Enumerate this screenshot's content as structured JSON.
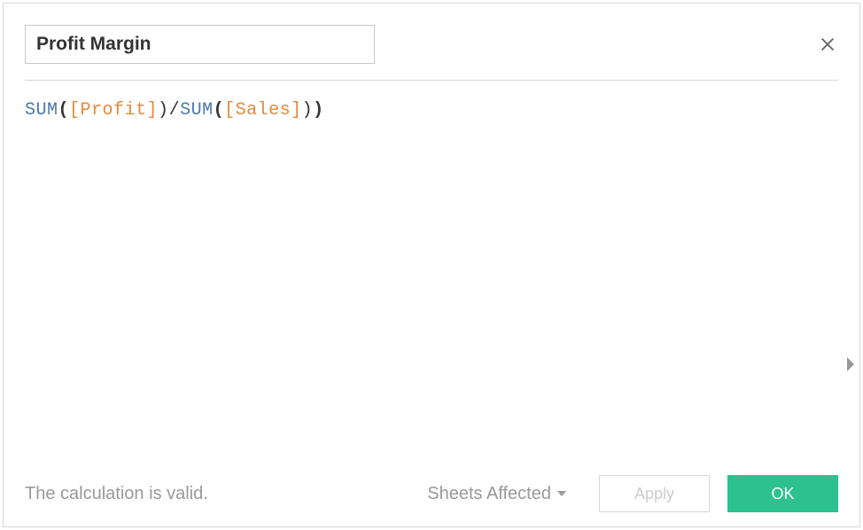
{
  "dialog": {
    "name_value": "Profit Margin",
    "formula_tokens": [
      {
        "type": "func",
        "text": "SUM"
      },
      {
        "type": "paren",
        "text": "(",
        "bold": true
      },
      {
        "type": "field",
        "text": "[Profit]"
      },
      {
        "type": "paren",
        "text": ")"
      },
      {
        "type": "op",
        "text": "/"
      },
      {
        "type": "func",
        "text": "SUM"
      },
      {
        "type": "paren",
        "text": "(",
        "bold": true
      },
      {
        "type": "field",
        "text": "[Sales]"
      },
      {
        "type": "paren",
        "text": ")"
      },
      {
        "type": "paren",
        "text": ")",
        "bold": true
      }
    ],
    "status": "The calculation is valid.",
    "sheets_affected_label": "Sheets Affected",
    "apply_label": "Apply",
    "ok_label": "OK"
  }
}
